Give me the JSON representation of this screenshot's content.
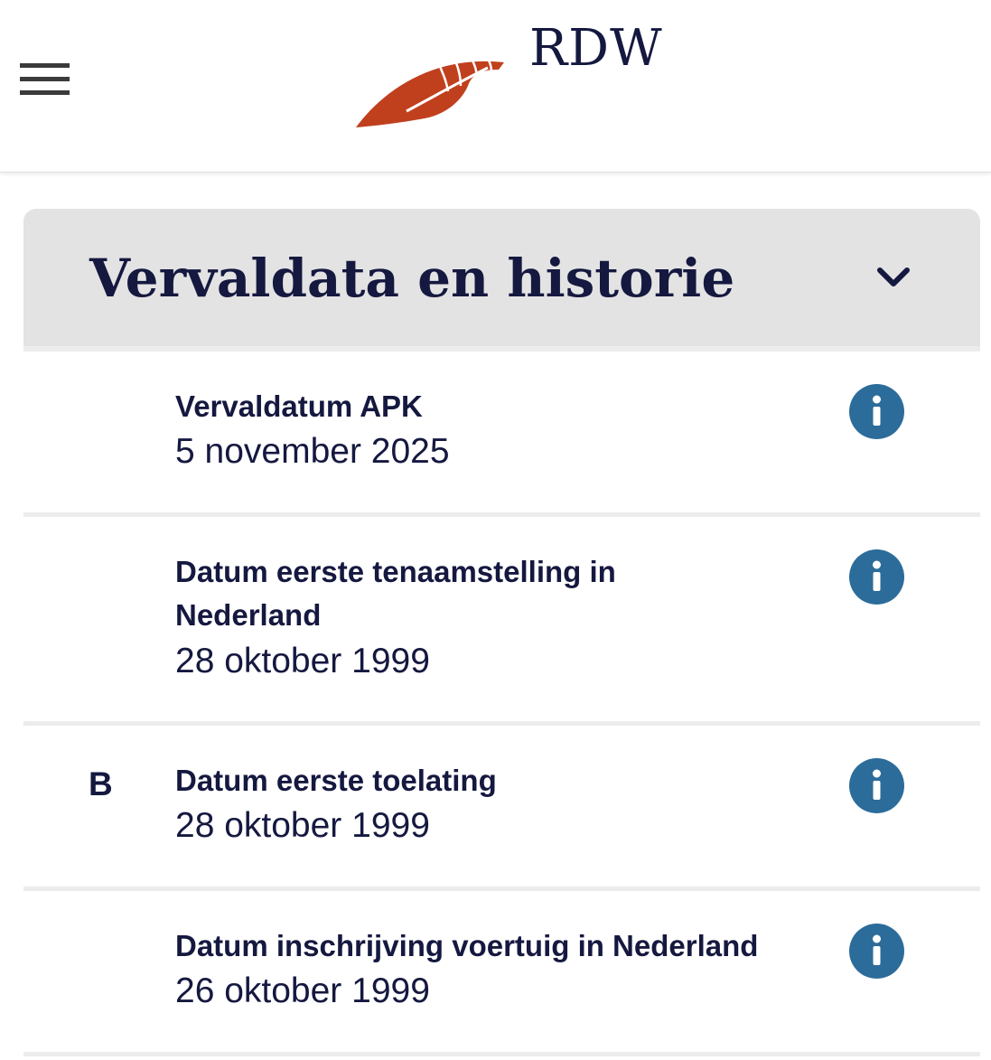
{
  "header": {
    "brand": "RDW",
    "colors": {
      "logo_accent": "#c0401e",
      "text": "#15183f"
    },
    "menu_icon": "hamburger-icon"
  },
  "section": {
    "title": "Vervaldata en historie",
    "toggle_icon": "chevron-down-icon",
    "background": "#e3e3e3",
    "rows": [
      {
        "code": "",
        "label": "Vervaldatum APK",
        "value": "5 november 2025",
        "icon": "info-icon"
      },
      {
        "code": "",
        "label": "Datum eerste tenaamstelling in Nederland",
        "value": "28 oktober 1999",
        "icon": "info-icon"
      },
      {
        "code": "B",
        "label": "Datum eerste toelating",
        "value": "28 oktober 1999",
        "icon": "info-icon"
      },
      {
        "code": "",
        "label": "Datum inschrijving voertuig in Nederland",
        "value": "26 oktober 1999",
        "icon": "info-icon"
      }
    ],
    "info_color": "#2c6c9a"
  }
}
